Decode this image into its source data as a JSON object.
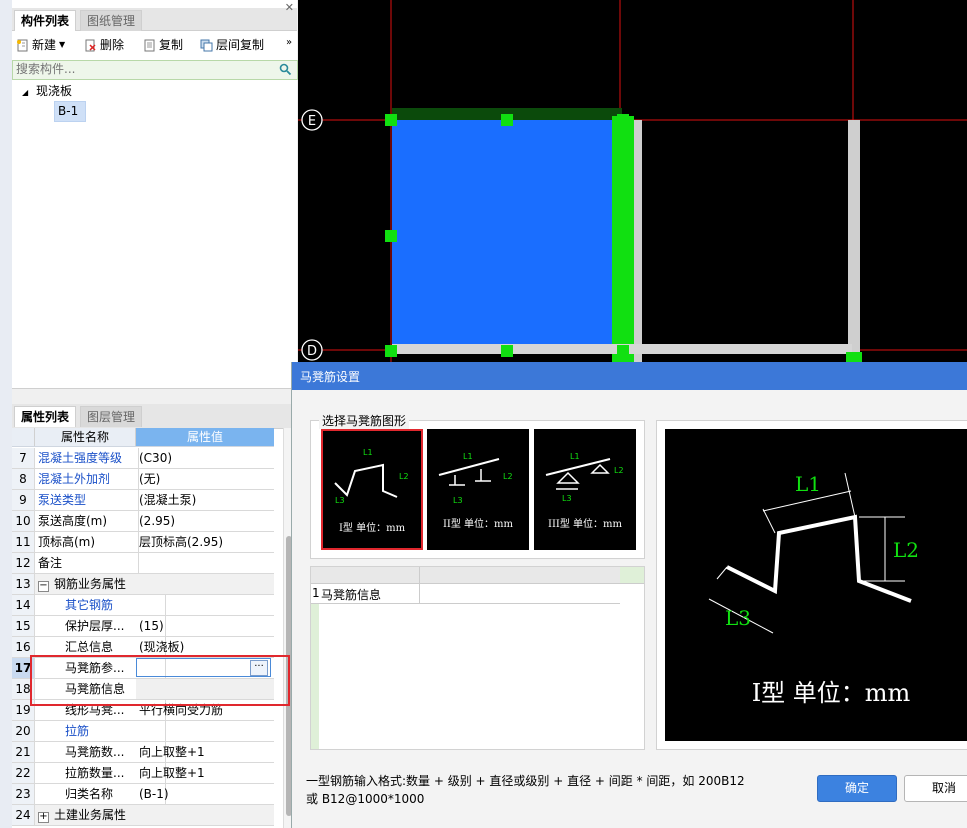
{
  "component_panel": {
    "tabs": [
      "构件列表",
      "图纸管理"
    ],
    "toolbar": {
      "new": "新建",
      "delete": "删除",
      "copy": "复制",
      "floor_copy": "层间复制"
    },
    "search_placeholder": "搜索构件...",
    "tree": {
      "root": "现浇板",
      "child": "B-1"
    }
  },
  "property_panel": {
    "tabs": [
      "属性列表",
      "图层管理"
    ],
    "headers": {
      "name": "属性名称",
      "value": "属性值"
    },
    "rows": [
      {
        "num": "7",
        "name": "混凝土强度等级",
        "value": "(C30)"
      },
      {
        "num": "8",
        "name": "混凝土外加剂",
        "value": "(无)"
      },
      {
        "num": "9",
        "name": "泵送类型",
        "value": "(混凝土泵)"
      },
      {
        "num": "10",
        "name": "泵送高度(m)",
        "value": "(2.95)"
      },
      {
        "num": "11",
        "name": "顶标高(m)",
        "value": "层顶标高(2.95)"
      },
      {
        "num": "12",
        "name": "备注",
        "value": ""
      },
      {
        "num": "13",
        "name": "钢筋业务属性",
        "value": ""
      },
      {
        "num": "14",
        "name": "其它钢筋",
        "value": ""
      },
      {
        "num": "15",
        "name": "保护层厚...",
        "value": "(15)"
      },
      {
        "num": "16",
        "name": "汇总信息",
        "value": "(现浇板)"
      },
      {
        "num": "17",
        "name": "马凳筋参...",
        "value": ""
      },
      {
        "num": "18",
        "name": "马凳筋信息",
        "value": ""
      },
      {
        "num": "19",
        "name": "线形马凳...",
        "value": "平行横向受力筋"
      },
      {
        "num": "20",
        "name": "拉筋",
        "value": ""
      },
      {
        "num": "21",
        "name": "马凳筋数...",
        "value": "向上取整+1"
      },
      {
        "num": "22",
        "name": "拉筋数量...",
        "value": "向上取整+1"
      },
      {
        "num": "23",
        "name": "归类名称",
        "value": "(B-1)"
      },
      {
        "num": "24",
        "name": "土建业务属性",
        "value": ""
      }
    ],
    "ellipsis": "···"
  },
  "canvas": {
    "axis_e": "E",
    "axis_d": "D"
  },
  "dialog": {
    "title": "马凳筋设置",
    "group_title": "选择马凳筋图形",
    "shapes": [
      {
        "label": "I型 单位：mm",
        "l1": "L1",
        "l2": "L2",
        "l3": "L3"
      },
      {
        "label": "II型 单位：mm",
        "l1": "L1",
        "l2": "L2",
        "l3": "L3"
      },
      {
        "label": "III型 单位：mm",
        "l1": "L1",
        "l2": "L2",
        "l3": "L3"
      }
    ],
    "grid": {
      "row_num": "1",
      "row_label": "马凳筋信息",
      "row_value": ""
    },
    "preview": {
      "l1": "L1",
      "l2": "L2",
      "l3": "L3",
      "caption": "I型 单位：mm"
    },
    "hint_line1": "一型钢筋输入格式:数量 + 级别 + 直径或级别 + 直径 + 间距 * 间距，如 200B12",
    "hint_line2": "或 B12@1000*1000",
    "ok": "确定",
    "cancel": "取消"
  },
  "colors": {
    "slab_blue": "#1a6eff",
    "grip_green": "#11e011",
    "beam_dark_green": "#0b4a0b",
    "title_blue": "#3c78d8",
    "highlight_red": "#e0282e"
  }
}
